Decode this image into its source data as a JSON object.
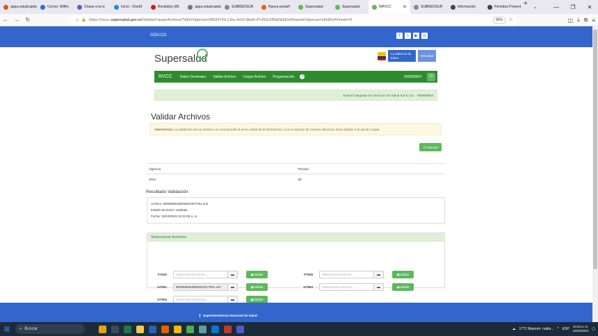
{
  "browser": {
    "tabs": [
      {
        "label": "appa.saludcapital",
        "color": "#d9541e"
      },
      {
        "label": "Correo: Wilfre",
        "color": "#2a6dd8"
      },
      {
        "label": "Únase a la re",
        "color": "#5a5fc8"
      },
      {
        "label": "Inicio - OneDr",
        "color": "#1e88e5"
      },
      {
        "label": "Recibidos (85",
        "color": "#c5221f"
      },
      {
        "label": "appa.saludcapital",
        "color": "#777777"
      },
      {
        "label": "SUBREDSUR",
        "color": "#888888"
      },
      {
        "label": "Nueva pestañ",
        "color": "#e66000"
      },
      {
        "label": "Supersalud -",
        "color": "#5cb85c"
      },
      {
        "label": "Supersalud",
        "color": "#5cb85c"
      },
      {
        "label": "NRVCC",
        "color": "#5cb85c",
        "active": true
      },
      {
        "label": "SUBREDSUR",
        "color": "#888888"
      },
      {
        "label": "Información",
        "color": "#444444"
      },
      {
        "label": "Periodos Present",
        "color": "#444444"
      }
    ],
    "url_prefix": "https://nrvcc.",
    "url_host": "supersalud.gov.co",
    "url_path": "/Validar/CargarArchivos?IdGnVigencia=0603475d-13ec-4c53-8ba6-47cf92c599d2&IdGnReporteVigencia=1&IdGnPeriodo=9",
    "zoom": "80%"
  },
  "gov": {
    "logo": "GOV.CO",
    "social": [
      "f",
      "t",
      "▶",
      "◎"
    ]
  },
  "site": {
    "brand": "Supersalud",
    "min_box": "La salud es de todos",
    "min_box2": "Minsalud"
  },
  "nav": {
    "home": "RVCC",
    "items": [
      "Datos Generales",
      "Validar Archivo",
      "Cargar Archivo",
      "Programación"
    ],
    "help": "?",
    "nit": "900958564"
  },
  "entity": "Subred Integrada De Servicios De Salud Sur E.S.E. - 900958564",
  "page": {
    "title": "Validar Archivos",
    "warning_bold": "Advertencia:",
    "warning_text": "La validación de los archivos no corresponde al envío oficial de la información, si va a reportar de manera oficial por favor diríjase a la opción cargar.",
    "historial_label": "Historial"
  },
  "info": {
    "h_vigencia": "Vigencia",
    "h_periodo": "Periodo",
    "v_vigencia": "2023",
    "v_periodo": "09"
  },
  "resultado": {
    "title": "Resultado Validación",
    "archivo": "Archivo: 90095856490092023GT001.xml",
    "estado": "Estado de Envío: Validado",
    "fecha": "Fecha: 19/10/2023 10:22:09 a. m."
  },
  "archivos": {
    "title": "Seleccionar Archivos",
    "placeholder": "Seleccione el archivo...",
    "validar_label": "Validar",
    "rows": [
      {
        "code": "FT010",
        "value": ""
      },
      {
        "code": "FT025",
        "value": ""
      },
      {
        "code": "GT001",
        "value": "90095856490092023GT001.xml"
      },
      {
        "code": "GT003",
        "value": ""
      },
      {
        "code": "GT004",
        "value": ""
      }
    ]
  },
  "footer": {
    "name": "Superintendencia Nacional de Salud"
  },
  "taskbar": {
    "search": "Buscar",
    "weather": "17°C  Mayorm. nubla...",
    "lang": "ESP",
    "time": "10:22 a. m.",
    "date": "19/10/2023"
  }
}
